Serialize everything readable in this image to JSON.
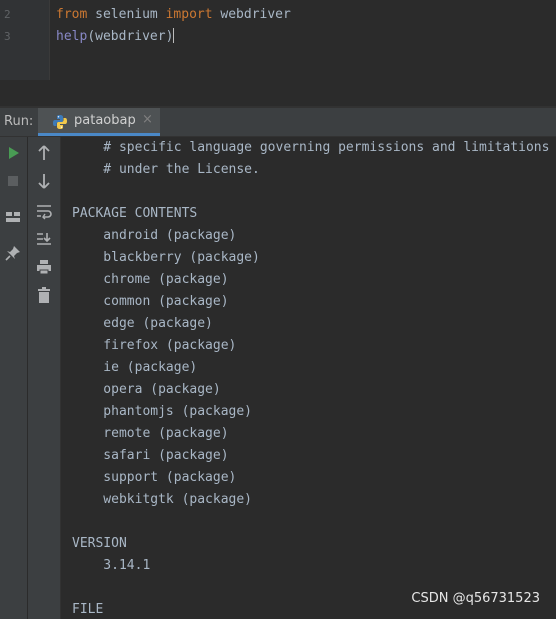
{
  "editor": {
    "lines": [
      {
        "number": "2",
        "parts": [
          {
            "text": "from",
            "cls": "kw"
          },
          {
            "text": " selenium ",
            "cls": ""
          },
          {
            "text": "import",
            "cls": "kw"
          },
          {
            "text": " webdriver",
            "cls": ""
          }
        ]
      },
      {
        "number": "3",
        "parts": [
          {
            "text": "help",
            "cls": "fn"
          },
          {
            "text": "(webdriver)",
            "cls": ""
          }
        ]
      }
    ]
  },
  "run_panel": {
    "label": "Run:",
    "tab_name": "pataobap",
    "tab_close": "×"
  },
  "toolbar_left": [
    {
      "name": "rerun-icon"
    },
    {
      "name": "stop-icon"
    },
    {
      "name": "layout-icon"
    },
    {
      "name": "pin-icon"
    }
  ],
  "toolbar_right": [
    {
      "name": "scroll-up-icon"
    },
    {
      "name": "scroll-down-icon"
    },
    {
      "name": "soft-wrap-icon"
    },
    {
      "name": "scroll-to-end-icon"
    },
    {
      "name": "print-icon"
    },
    {
      "name": "trash-icon"
    }
  ],
  "console": {
    "lines": [
      "    # specific language governing permissions and limitations",
      "    # under the License.",
      "",
      "PACKAGE CONTENTS",
      "    android (package)",
      "    blackberry (package)",
      "    chrome (package)",
      "    common (package)",
      "    edge (package)",
      "    firefox (package)",
      "    ie (package)",
      "    opera (package)",
      "    phantomjs (package)",
      "    remote (package)",
      "    safari (package)",
      "    support (package)",
      "    webkitgtk (package)",
      "",
      "VERSION",
      "    3.14.1",
      "",
      "FILE"
    ]
  },
  "watermark": "CSDN @q56731523",
  "colors": {
    "background": "#2b2b2b",
    "panel": "#3c3f41",
    "keyword": "#cc7832",
    "builtin": "#8888c6",
    "text": "#a9b7c6",
    "run_green": "#499c54",
    "accent_blue": "#4a88c7"
  }
}
